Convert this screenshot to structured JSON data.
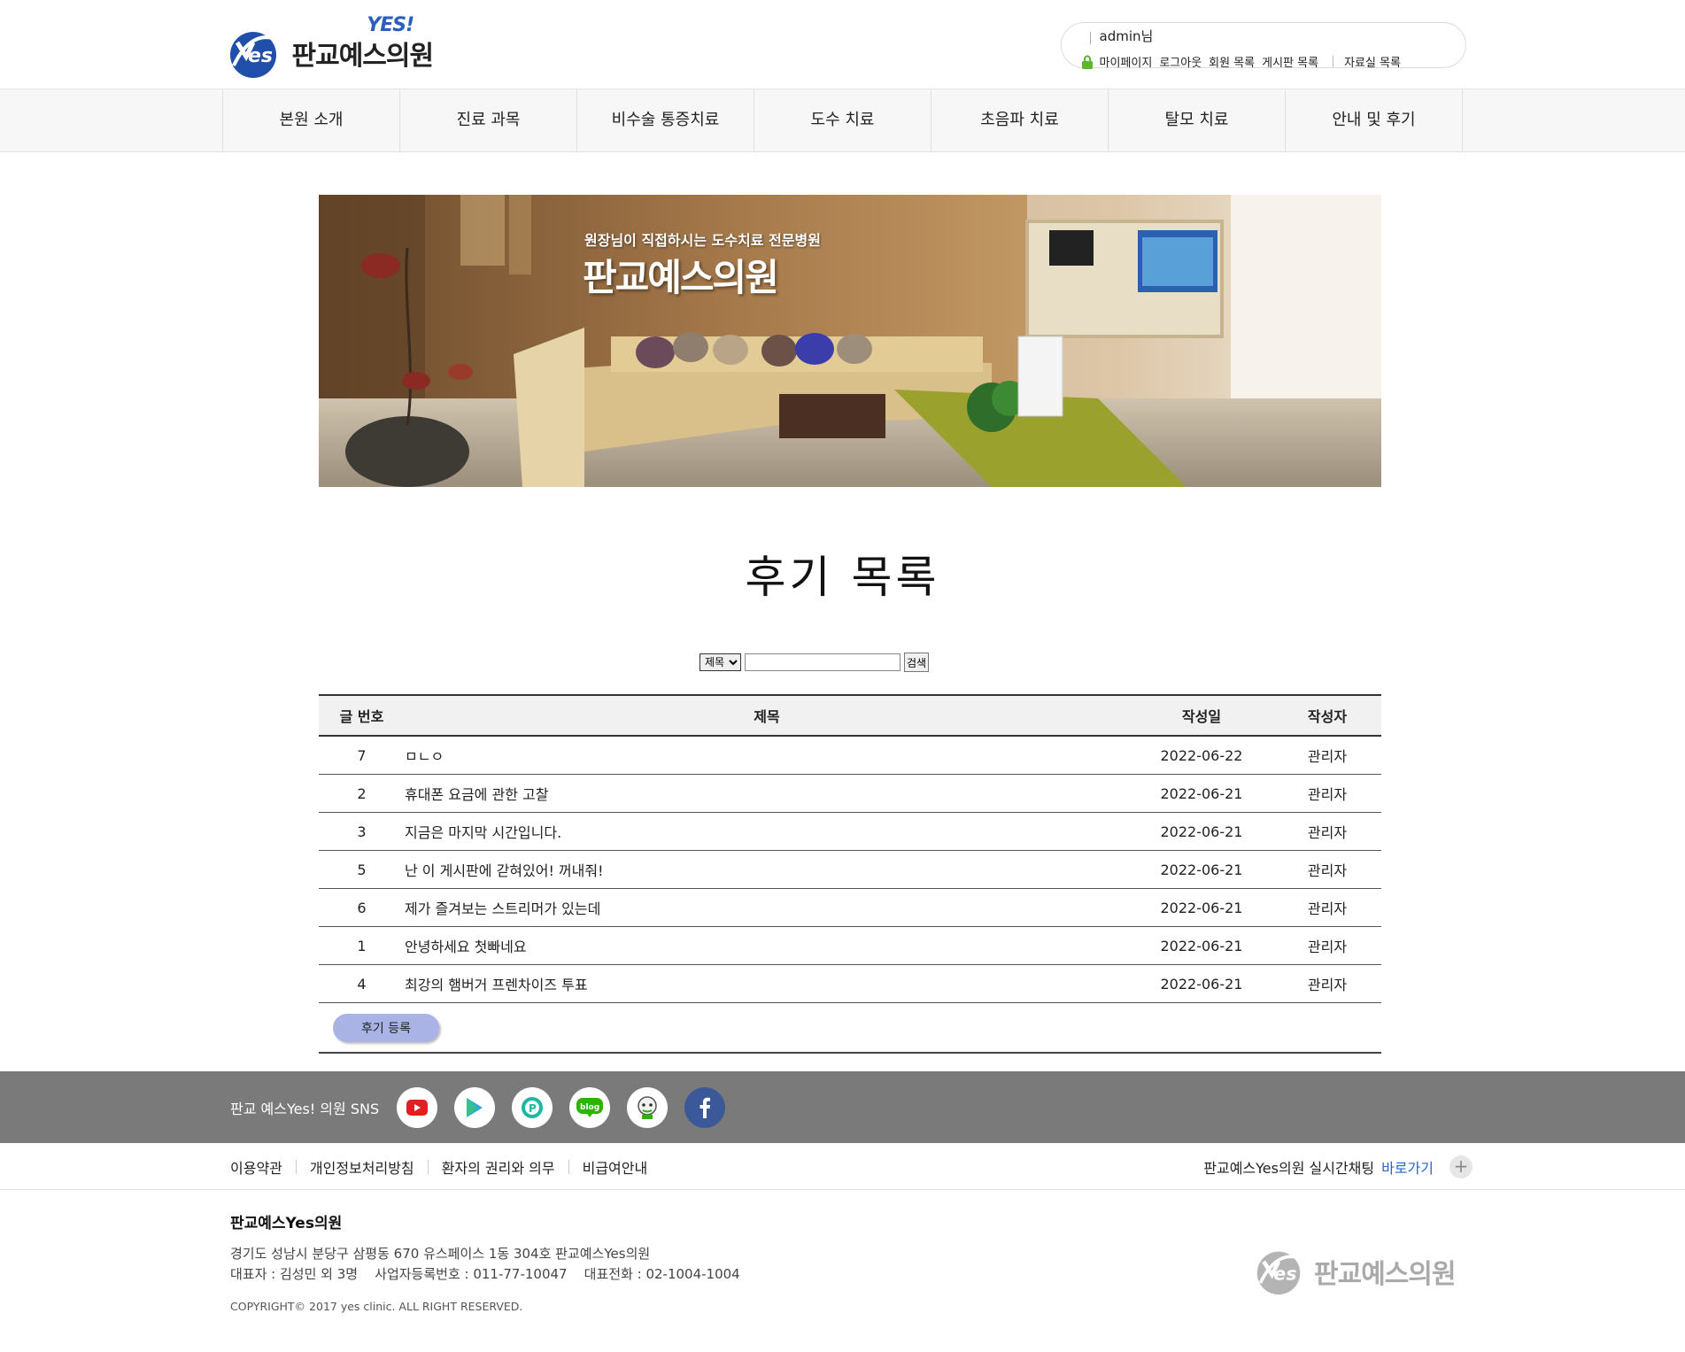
{
  "header": {
    "logo_text": "판교예스의원",
    "logo_badge": "YES!",
    "user_name": "admin님",
    "user_links": [
      "마이페이지",
      "로그아웃",
      "회원 목록",
      "게시판 목록"
    ],
    "user_link_extra": "자료실 목록"
  },
  "nav": [
    {
      "label": "본원 소개"
    },
    {
      "label": "진료 과목"
    },
    {
      "label": "비수술 통증치료"
    },
    {
      "label": "도수 치료"
    },
    {
      "label": "초음파 치료"
    },
    {
      "label": "탈모 치료"
    },
    {
      "label": "안내 및 후기"
    }
  ],
  "banner": {
    "subtitle": "원장님이 직접하시는 도수치료 전문병원",
    "title": "판교예스의원"
  },
  "page_title": "후기 목록",
  "search": {
    "select_value": "제목",
    "input_value": "",
    "button_label": "검색"
  },
  "table": {
    "headers": {
      "num": "글 번호",
      "title": "제목",
      "date": "작성일",
      "author": "작성자"
    },
    "rows": [
      {
        "num": "7",
        "title": "ㅁㄴㅇ",
        "date": "2022-06-22",
        "author": "관리자"
      },
      {
        "num": "2",
        "title": "휴대폰 요금에 관한 고찰",
        "date": "2022-06-21",
        "author": "관리자"
      },
      {
        "num": "3",
        "title": "지금은 마지막 시간입니다.",
        "date": "2022-06-21",
        "author": "관리자"
      },
      {
        "num": "5",
        "title": "난 이 게시판에 갇혀있어! 꺼내줘!",
        "date": "2022-06-21",
        "author": "관리자"
      },
      {
        "num": "6",
        "title": "제가 즐겨보는 스트리머가 있는데",
        "date": "2022-06-21",
        "author": "관리자"
      },
      {
        "num": "1",
        "title": "안녕하세요 첫빠네요",
        "date": "2022-06-21",
        "author": "관리자"
      },
      {
        "num": "4",
        "title": "최강의 햄버거 프렌차이즈 투표",
        "date": "2022-06-21",
        "author": "관리자"
      }
    ]
  },
  "register_button": "후기 등록",
  "sns": {
    "label": "판교 예스Yes! 의원 SNS",
    "icons": [
      "youtube-icon",
      "google-play-icon",
      "pinkfong-icon",
      "naver-blog-icon",
      "kakao-story-icon",
      "facebook-icon"
    ]
  },
  "footer": {
    "links": [
      "이용약관",
      "개인정보처리방침",
      "환자의 권리와 의무",
      "비급여안내"
    ],
    "chat_text": "판교예스Yes의원 실시간채팅",
    "chat_link": "바로가기",
    "name": "판교예스Yes의원",
    "address": "경기도 성남시 분당구 삼평동 670 유스페이스 1동 304호 판교예스Yes의원",
    "rep_line": "대표자 : 김성민 외 3명    사업자등록번호 : 011-77-10047    대표전화 : 02-1004-1004",
    "copyright": "COPYRIGHT© 2017 yes clinic. ALL RIGHT RESERVED.",
    "logo_text": "판교예스의원"
  },
  "colors": {
    "accent_blue": "#2a5fbd",
    "register_button": "#a9b3e6",
    "sns_band": "#7a7a7a",
    "chat_link": "#2a64c8"
  }
}
